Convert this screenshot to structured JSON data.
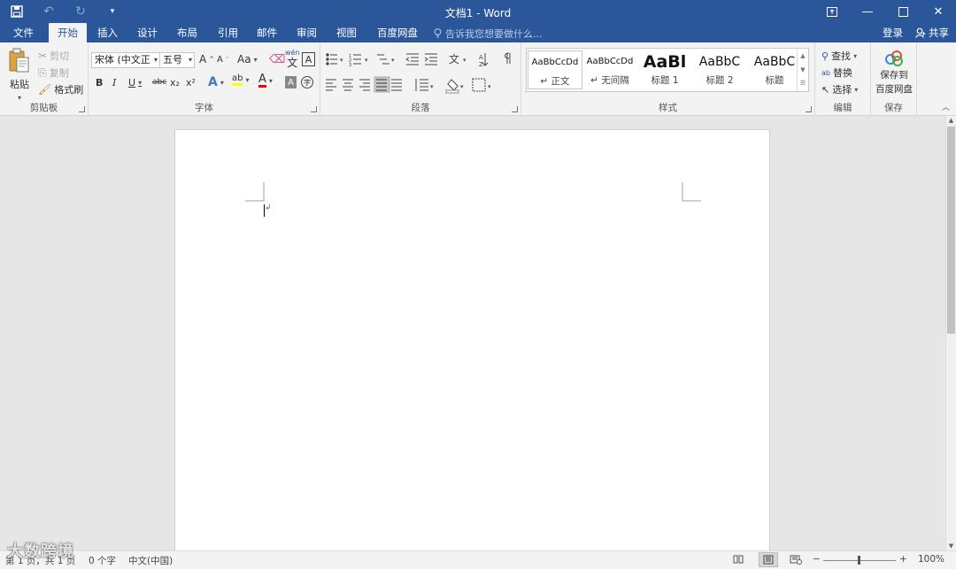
{
  "titlebar": {
    "title": "文档1 - Word",
    "qat": [
      "save-icon",
      "undo-icon",
      "redo-icon",
      "customize-icon"
    ],
    "controls": [
      "ribbon-display-icon",
      "minimize-icon",
      "maximize-icon",
      "close-icon"
    ]
  },
  "tabs": [
    "文件",
    "开始",
    "插入",
    "设计",
    "布局",
    "引用",
    "邮件",
    "审阅",
    "视图",
    "百度网盘"
  ],
  "active_tab": "开始",
  "tellme": "告诉我您想要做什么...",
  "account": {
    "signin": "登录",
    "share": "共享"
  },
  "clipboard": {
    "paste": "粘贴",
    "cut": "剪切",
    "copy": "复制",
    "format_painter": "格式刷",
    "label": "剪贴板"
  },
  "font": {
    "name": "宋体 (中文正",
    "size": "五号",
    "case": "Aa",
    "label": "字体",
    "bold": "B",
    "italic": "I",
    "underline": "U",
    "strike": "abc",
    "sub": "x₂",
    "sup": "x²"
  },
  "paragraph": {
    "label": "段落"
  },
  "styles": {
    "label": "样式",
    "items": [
      {
        "sample": "AaBbCcDd",
        "name": "↵ 正文"
      },
      {
        "sample": "AaBbCcDd",
        "name": "↵ 无间隔"
      },
      {
        "sample": "AaBl",
        "name": "标题 1"
      },
      {
        "sample": "AaBbC",
        "name": "标题 2"
      },
      {
        "sample": "AaBbC",
        "name": "标题"
      }
    ]
  },
  "editing": {
    "find": "查找",
    "replace": "替换",
    "select": "选择",
    "label": "编辑"
  },
  "save": {
    "button": "保存到百度网盘",
    "line1": "保存到",
    "line2": "百度网盘",
    "label": "保存"
  },
  "status": {
    "page": "第 1 页，共 1 页",
    "words": "0 个字",
    "lang": "中文(中国)",
    "zoom": "100%"
  },
  "watermark": "大数跨境",
  "colors": {
    "accent": "#2b579a",
    "highlight": "#ffff00",
    "font_color": "#ff0000"
  }
}
